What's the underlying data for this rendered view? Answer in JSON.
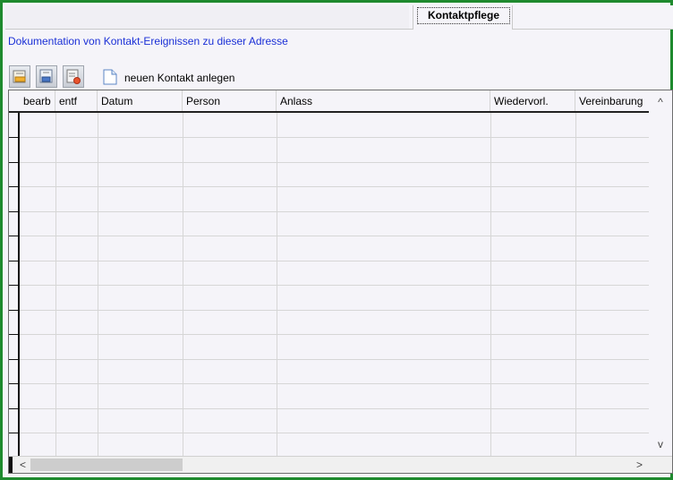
{
  "tabs": [
    {
      "label": "Kontaktpflege",
      "active": true
    }
  ],
  "doc_link": "Dokumentation von Kontakt-Ereignissen zu dieser Adresse",
  "toolbar": {
    "buttons": [
      {
        "icon": "edit-contact-icon"
      },
      {
        "icon": "save-contact-icon"
      },
      {
        "icon": "delete-contact-icon"
      }
    ],
    "new_contact_label": "neuen Kontakt anlegen",
    "new_contact_icon": "new-document-icon"
  },
  "grid": {
    "columns": [
      "bearb",
      "entf",
      "Datum",
      "Person",
      "Anlass",
      "Wiedervorl.",
      "Vereinbarung"
    ],
    "rows": []
  },
  "scrollbars": {
    "up_arrow": "^",
    "down_arrow": "v",
    "left_arrow": "<",
    "right_arrow": ">"
  },
  "colors": {
    "frame": "#1e8a2e",
    "link": "#1a2fd6"
  }
}
